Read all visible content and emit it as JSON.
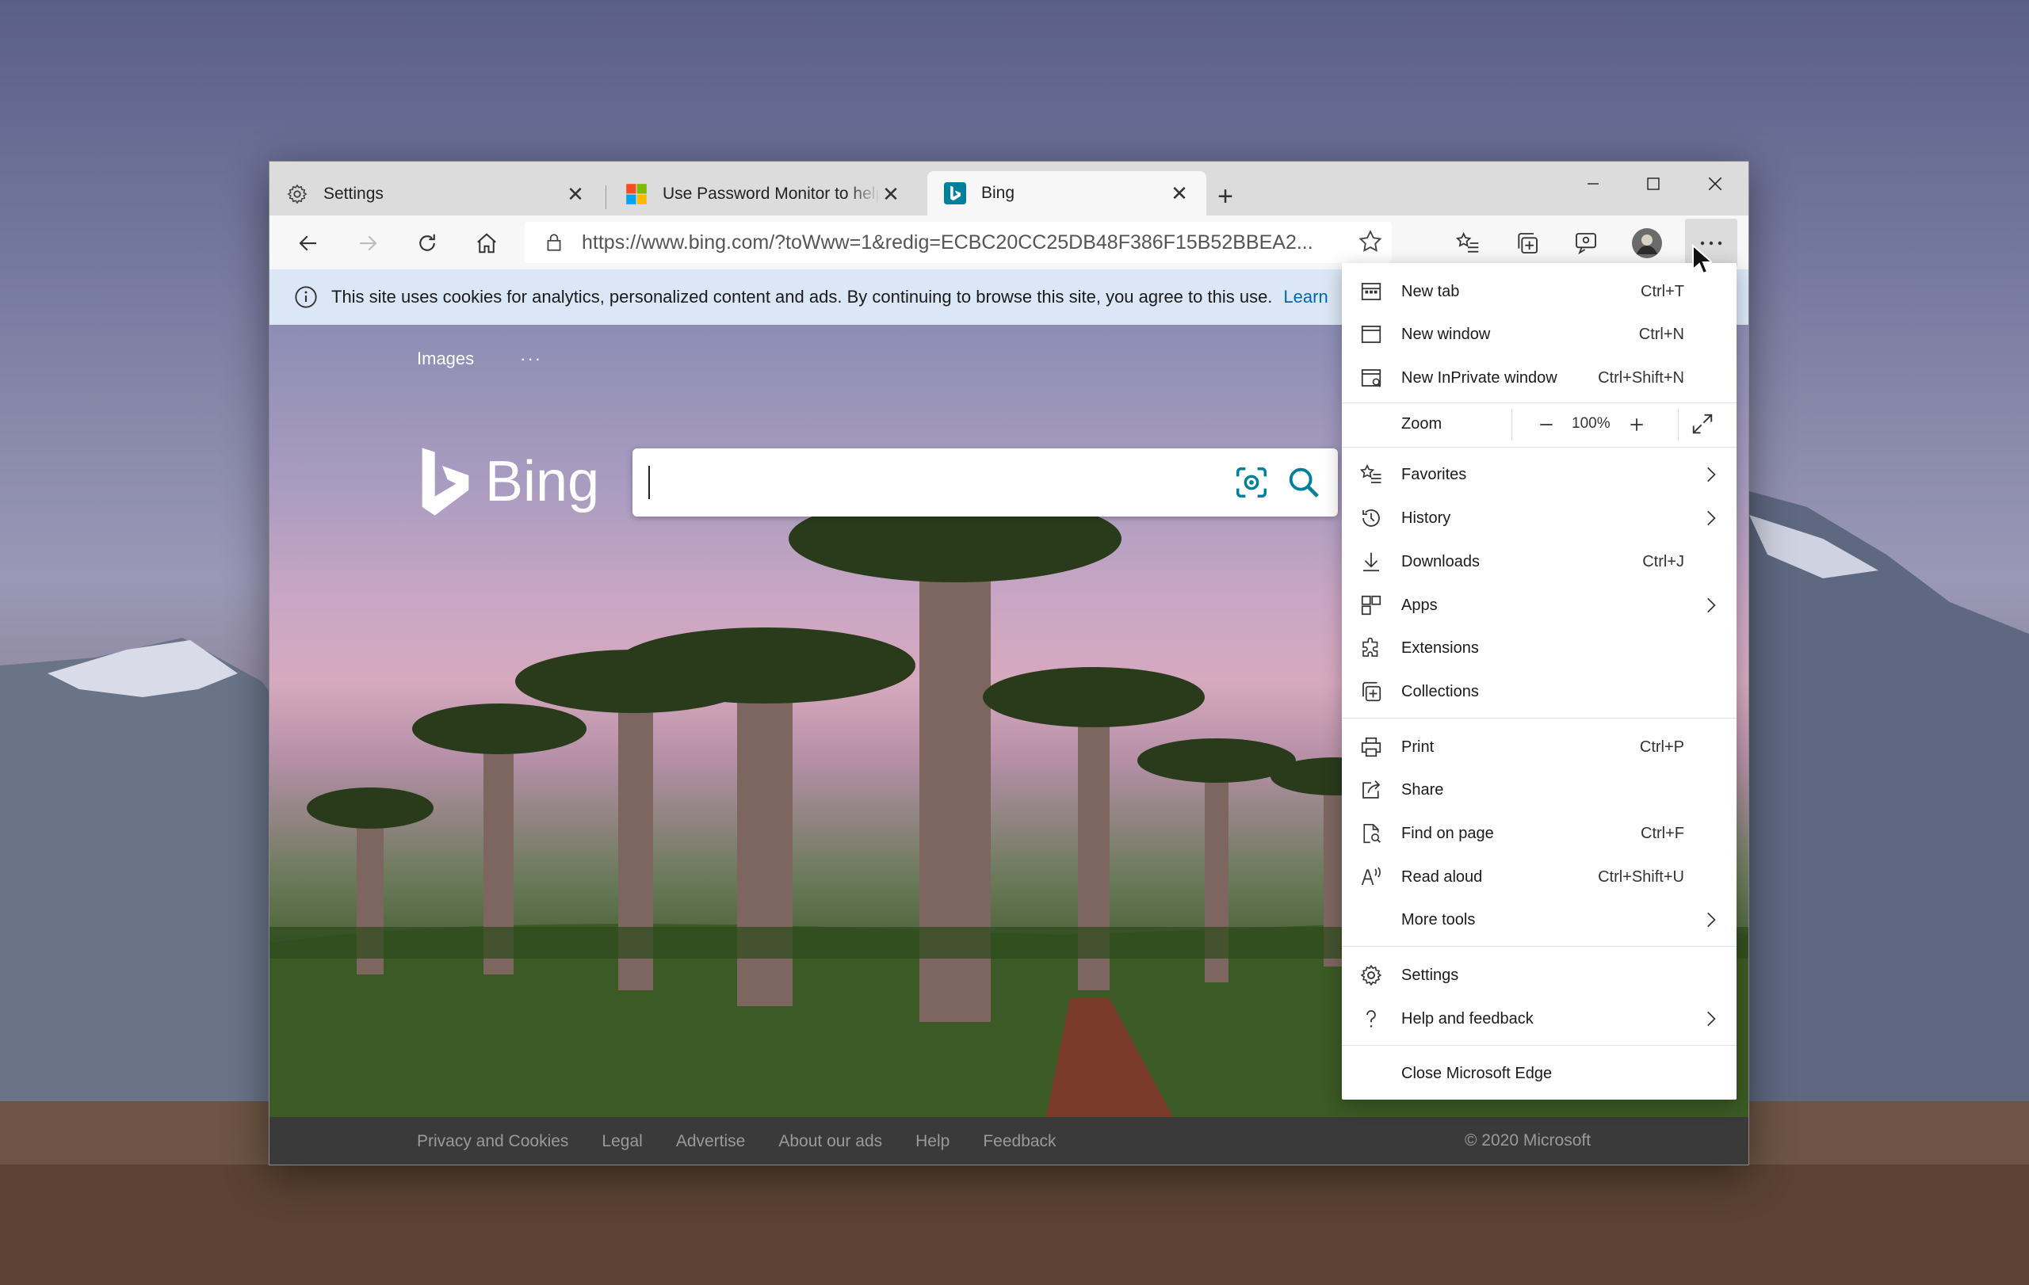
{
  "tabs": [
    {
      "title": "Settings",
      "icon": "gear-icon"
    },
    {
      "title": "Use Password Monitor to help pro",
      "icon": "microsoft-logo-icon"
    },
    {
      "title": "Bing",
      "icon": "bing-logo-icon",
      "active": true
    }
  ],
  "toolbar": {
    "url": "https://www.bing.com/?toWww=1&redig=ECBC20CC25DB48F386F15B52BBEA2..."
  },
  "infobar": {
    "message": "This site uses cookies for analytics, personalized content and ads. By continuing to browse this site, you agree to this use.",
    "link": "Learn"
  },
  "bing": {
    "nav_images": "Images",
    "nav_more": "···",
    "logo_text": "Bing"
  },
  "footer": {
    "links": [
      "Privacy and Cookies",
      "Legal",
      "Advertise",
      "About our ads",
      "Help",
      "Feedback"
    ],
    "copyright": "© 2020 Microsoft"
  },
  "menu": {
    "new_tab": {
      "label": "New tab",
      "shortcut": "Ctrl+T"
    },
    "new_window": {
      "label": "New window",
      "shortcut": "Ctrl+N"
    },
    "new_inprivate": {
      "label": "New InPrivate window",
      "shortcut": "Ctrl+Shift+N"
    },
    "zoom": {
      "label": "Zoom",
      "minus": "—",
      "value": "100%",
      "plus": "+"
    },
    "favorites": {
      "label": "Favorites"
    },
    "history": {
      "label": "History"
    },
    "downloads": {
      "label": "Downloads",
      "shortcut": "Ctrl+J"
    },
    "apps": {
      "label": "Apps"
    },
    "extensions": {
      "label": "Extensions"
    },
    "collections": {
      "label": "Collections"
    },
    "print": {
      "label": "Print",
      "shortcut": "Ctrl+P"
    },
    "share": {
      "label": "Share"
    },
    "find": {
      "label": "Find on page",
      "shortcut": "Ctrl+F"
    },
    "read_aloud": {
      "label": "Read aloud",
      "shortcut": "Ctrl+Shift+U"
    },
    "more_tools": {
      "label": "More tools"
    },
    "settings": {
      "label": "Settings"
    },
    "help": {
      "label": "Help and feedback"
    },
    "close": {
      "label": "Close Microsoft Edge"
    }
  },
  "colors": {
    "accent": "#0067b8",
    "infobar": "#dbe7f7",
    "bing_teal": "#00809d"
  }
}
